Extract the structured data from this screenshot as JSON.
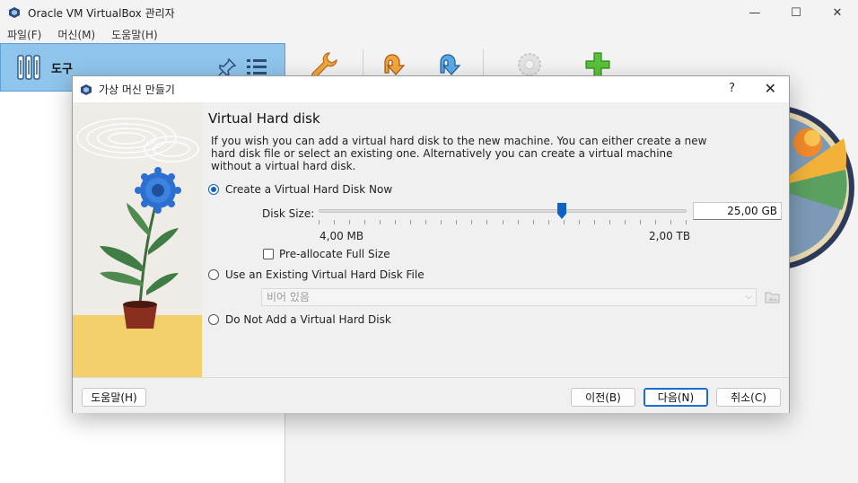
{
  "window": {
    "title": "Oracle VM VirtualBox 관리자",
    "controls": {
      "minimize": "—",
      "maximize": "☐",
      "close": "✕"
    }
  },
  "menu": [
    "파일(F)",
    "머신(M)",
    "도움말(H)"
  ],
  "tools": {
    "label": "도구"
  },
  "toolbar": {
    "icons": [
      "wrench-icon",
      "import-icon",
      "export-icon",
      "gear-icon",
      "add-icon"
    ]
  },
  "dialog": {
    "title": "가상 머신 만들기",
    "help": "?",
    "close": "✕",
    "heading": "Virtual Hard disk",
    "description": "If you wish you can add a virtual hard disk to the new machine. You can either create a new hard disk file or select an existing one. Alternatively you can create a virtual machine without a virtual hard disk.",
    "options": {
      "create": "Create a Virtual Hard Disk Now",
      "use_existing": "Use an Existing Virtual Hard Disk File",
      "no_disk": "Do Not Add a Virtual Hard Disk"
    },
    "selected_option": "create",
    "disk_size": {
      "label": "Disk Size:",
      "value": "25,00 GB",
      "min_label": "4,00 MB",
      "max_label": "2,00 TB",
      "slider_fraction": 0.66
    },
    "preallocate": {
      "label": "Pre-allocate Full Size",
      "checked": false
    },
    "existing_file": {
      "value": "비어 있음"
    },
    "buttons": {
      "help": "도움말(H)",
      "back": "이전(B)",
      "next": "다음(N)",
      "cancel": "취소(C)"
    }
  },
  "colors": {
    "accent": "#0f62c4",
    "tools_bg": "#8fc4ec"
  }
}
